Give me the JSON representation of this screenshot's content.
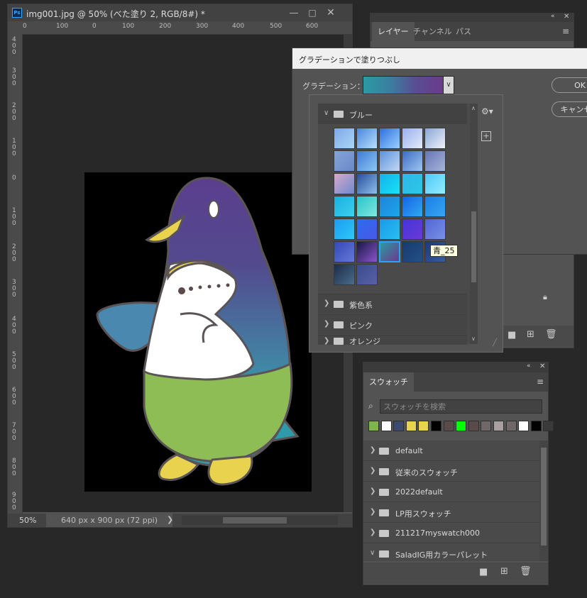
{
  "document": {
    "title": "img001.jpg @ 50% (べた塗り 2, RGB/8#) *",
    "app_icon": "Ps",
    "zoom": "50%",
    "size_info": "640 px x 900 px (72 ppi)",
    "ruler_top": [
      "0",
      "100",
      "0",
      "100",
      "200",
      "300",
      "400",
      "500",
      "600"
    ],
    "ruler_left": [
      "400",
      "300",
      "200",
      "100",
      "0",
      "100",
      "200",
      "300",
      "400",
      "500",
      "600",
      "700",
      "800",
      "900"
    ]
  },
  "layers_panel": {
    "tabs": [
      "レイヤー",
      "チャンネル",
      "パス"
    ]
  },
  "gradient_dialog": {
    "title": "グラデーションで塗りつぶし",
    "gradient_label": "グラデーション：",
    "ok": "OK",
    "cancel": "キャンセル"
  },
  "gradient_picker": {
    "open_folder": "ブルー",
    "tooltip": "青_25",
    "other_folders": [
      "紫色系",
      "ピンク",
      "オレンジ"
    ],
    "tiles": [
      [
        "#7fa8e8",
        "#a9d6f6"
      ],
      [
        "#4a86e2",
        "#b7e0fa"
      ],
      [
        "#2d6fe0",
        "#9ad0ff"
      ],
      [
        "#9ab0f0",
        "#e3eaf9"
      ],
      [
        "#88a6d8",
        "#f0f2f7"
      ],
      [
        "#86a4d8",
        "#6a88c8"
      ],
      [
        "#3f7ad6",
        "#8cc6f4"
      ],
      [
        "#5c92de",
        "#c3d8f2"
      ],
      [
        "#3c6cc4",
        "#9ec6f0"
      ],
      [
        "#6676b8",
        "#a8b4d8"
      ],
      [
        "#d8a8c8",
        "#6c8cd0"
      ],
      [
        "#2a4c9c",
        "#8cc0ec"
      ],
      [
        "#14b0ec",
        "#18e2f6"
      ],
      [
        "#30b6e8",
        "#2ac8e8"
      ],
      [
        "#4cc8f8",
        "#96ecff"
      ],
      [
        "#18b0e0",
        "#3cd0f0"
      ],
      [
        "#28c4c8",
        "#80e8e0"
      ],
      [
        "#1e84d8",
        "#1ca6ec"
      ],
      [
        "#1464e6",
        "#30a8f2"
      ],
      [
        "#1880e8",
        "#38a4f0"
      ],
      [
        "#1c9cf0",
        "#2ec8f8"
      ],
      [
        "#2a6cf0",
        "#4a58e6"
      ],
      [
        "#1a98e8",
        "#28c0f4"
      ],
      [
        "#4434d8",
        "#6a3ad8"
      ],
      [
        "#5066d8",
        "#7a90e4"
      ],
      [
        "#3448b8",
        "#6478d8"
      ],
      [
        "#181848",
        "#8a54c8"
      ],
      [
        "#2a9aa4",
        "#6b3a8c"
      ],
      [
        "#183a6c",
        "#24508a"
      ],
      [
        "#1a3a78",
        "#385ca0"
      ],
      [
        "#1c2c48",
        "#4a6c8c"
      ],
      [
        "#3a4c8c",
        "#5a60a8"
      ]
    ]
  },
  "swatches_panel": {
    "tab": "スウォッチ",
    "search_placeholder": "スウォッチを検索",
    "recent_colors": [
      "#7fb34e",
      "#ffffff",
      "#3c4a70",
      "#e8d44a",
      "#e8d44a",
      "#000000",
      "#5a4a4a",
      "#00ff00",
      "#5a4a4a",
      "#706868",
      "#a8a0a0",
      "#706868",
      "#ffffff",
      "#000000",
      "#3a3a3a"
    ],
    "groups": [
      "default",
      "従来のスウォッチ",
      "2022default",
      "LP用スウォッチ",
      "211217myswatch000",
      "SaladIG用カラーパレット"
    ]
  },
  "colors": {
    "panel_bg": "#535353",
    "penguin_head_top": "#5a3f8e",
    "penguin_head_bottom": "#3a8ea6",
    "penguin_belly": "#8ebd55",
    "penguin_beak": "#e8d24e",
    "artboard": "#000000"
  }
}
